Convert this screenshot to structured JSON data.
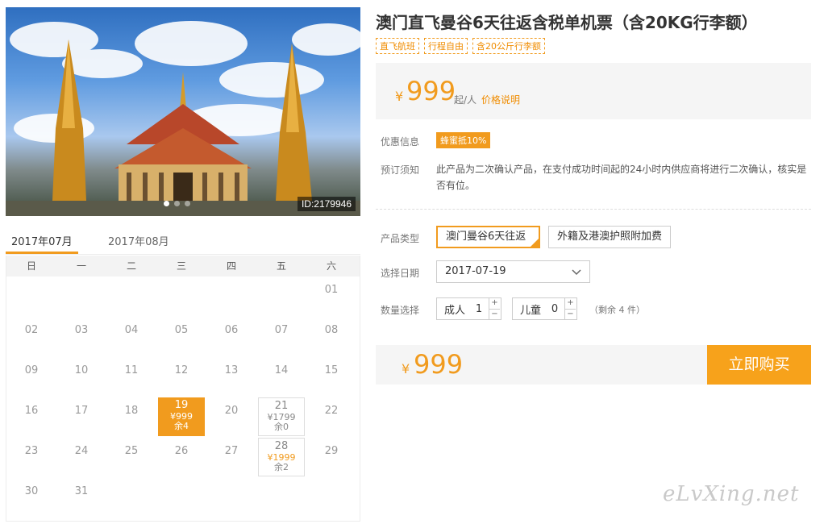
{
  "photo": {
    "id_label": "ID:2179946"
  },
  "calendar": {
    "months": [
      "2017年07月",
      "2017年08月"
    ],
    "weekdays": [
      "日",
      "一",
      "二",
      "三",
      "四",
      "五",
      "六"
    ],
    "days": [
      {
        "d": ""
      },
      {
        "d": ""
      },
      {
        "d": ""
      },
      {
        "d": ""
      },
      {
        "d": ""
      },
      {
        "d": ""
      },
      {
        "d": "01"
      },
      {
        "d": "02"
      },
      {
        "d": "03"
      },
      {
        "d": "04"
      },
      {
        "d": "05"
      },
      {
        "d": "06"
      },
      {
        "d": "07"
      },
      {
        "d": "08"
      },
      {
        "d": "09"
      },
      {
        "d": "10"
      },
      {
        "d": "11"
      },
      {
        "d": "12"
      },
      {
        "d": "13"
      },
      {
        "d": "14"
      },
      {
        "d": "15"
      },
      {
        "d": "16"
      },
      {
        "d": "17"
      },
      {
        "d": "18"
      },
      {
        "d": "19",
        "price": "¥999",
        "stock": "余4",
        "state": "sel"
      },
      {
        "d": "20"
      },
      {
        "d": "21",
        "price": "¥1799",
        "stock": "余0",
        "state": "avail"
      },
      {
        "d": "22"
      },
      {
        "d": "23"
      },
      {
        "d": "24"
      },
      {
        "d": "25"
      },
      {
        "d": "26"
      },
      {
        "d": "27"
      },
      {
        "d": "28",
        "price": "¥1999",
        "stock": "余2",
        "state": "avail",
        "hot": true
      },
      {
        "d": "29"
      },
      {
        "d": "30"
      },
      {
        "d": "31"
      }
    ]
  },
  "product": {
    "title": "澳门直飞曼谷6天往返含税单机票（含20KG行李额）",
    "tags": [
      "直飞航班",
      "行程自由",
      "含20公斤行李额"
    ],
    "price_symbol": "¥",
    "price": "999",
    "price_unit": "起/人",
    "price_explain": "价格说明"
  },
  "info": {
    "discount_label": "优惠信息",
    "discount_badge": "蜂蜜抵10%",
    "notice_label": "预订须知",
    "notice_text": "此产品为二次确认产品，在支付成功时间起的24小时内供应商将进行二次确认，核实是否有位。"
  },
  "form": {
    "type_label": "产品类型",
    "type_options": [
      "澳门曼谷6天往返",
      "外籍及港澳护照附加费"
    ],
    "date_label": "选择日期",
    "date_value": "2017-07-19",
    "qty_label": "数量选择",
    "adult_label": "成人",
    "adult_value": "1",
    "child_label": "儿童",
    "child_value": "0",
    "plus": "+",
    "minus": "−",
    "remaining": "（剩余 4 件）"
  },
  "buy": {
    "price_symbol": "¥",
    "price": "999",
    "button": "立即购买"
  },
  "watermark": "eLvXing.net",
  "colors": {
    "accent": "#f19b1e",
    "button": "#f7a21b"
  }
}
